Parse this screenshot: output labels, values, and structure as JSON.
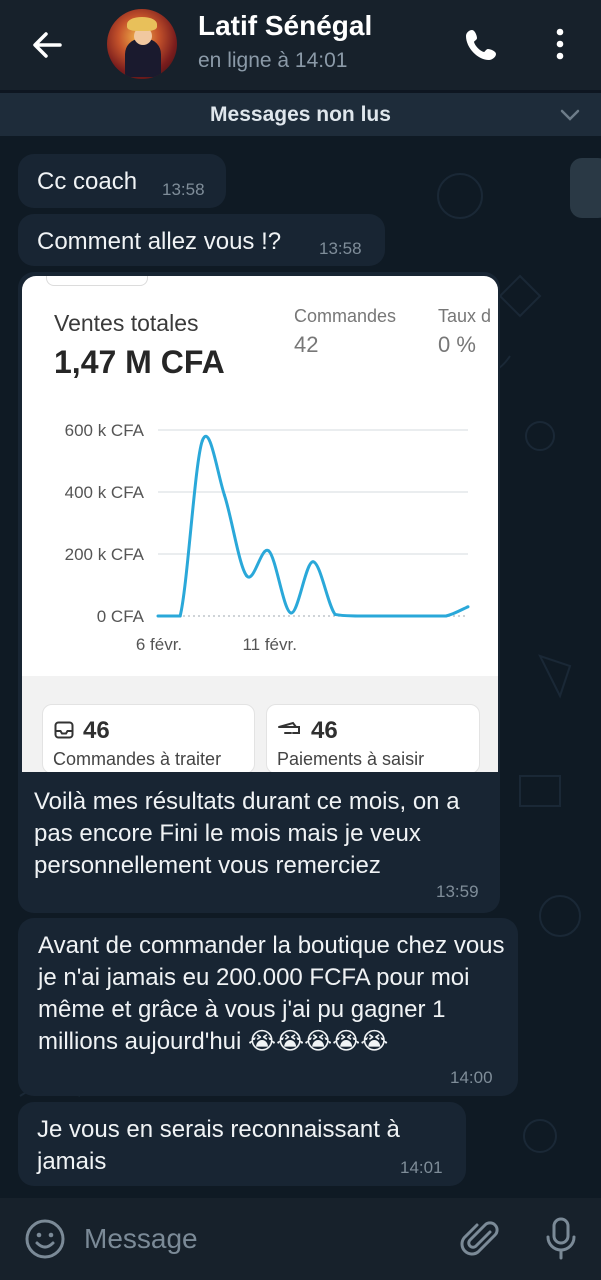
{
  "header": {
    "contact_name": "Latif Sénégal",
    "status": "en ligne à 14:01"
  },
  "unread_banner": "Messages non lus",
  "messages": [
    {
      "text": "Cc coach",
      "time": "13:58"
    },
    {
      "text": "Comment allez vous !?",
      "time": "13:58"
    },
    {
      "type": "image",
      "caption": "Voilà mes résultats durant ce mois, on a pas encore Fini le mois mais je veux personnellement vous remerciez",
      "time": "13:59"
    },
    {
      "text": "Avant de commander la boutique chez vous je n'ai jamais eu 200.000 FCFA pour moi même et grâce à vous j'ai pu gagner 1 millions aujourd'hui 😭😭😭😭😭",
      "time": "14:00"
    },
    {
      "text": "Je vous en serais reconnaissant à jamais",
      "time": "14:01"
    }
  ],
  "screenshot": {
    "total_label": "Ventes totales",
    "total_value": "1,47 M CFA",
    "orders_label": "Commandes",
    "orders_value": "42",
    "rate_label": "Taux d",
    "rate_value": "0 %",
    "card1_num": "46",
    "card1_label": "Commandes à traiter",
    "card2_num": "46",
    "card2_label": "Paiements à saisir"
  },
  "chart_data": {
    "type": "line",
    "x": [
      0,
      1,
      2,
      3,
      4,
      5,
      6,
      7,
      8,
      9,
      10,
      11,
      12,
      13,
      14
    ],
    "values": [
      0,
      0,
      565,
      390,
      130,
      210,
      10,
      175,
      5,
      0,
      0,
      0,
      0,
      0,
      30
    ],
    "xticks": [
      "6 févr.",
      "11 févr."
    ],
    "yticks": [
      "0 CFA",
      "200 k CFA",
      "400 k CFA",
      "600 k CFA"
    ],
    "ylim": [
      0,
      600000
    ],
    "color": "#2aa8d9"
  },
  "composer": {
    "placeholder": "Message"
  },
  "colors": {
    "header_bg": "#17212b",
    "bubble_bg": "#182533",
    "chart_line": "#2aa8d9"
  }
}
